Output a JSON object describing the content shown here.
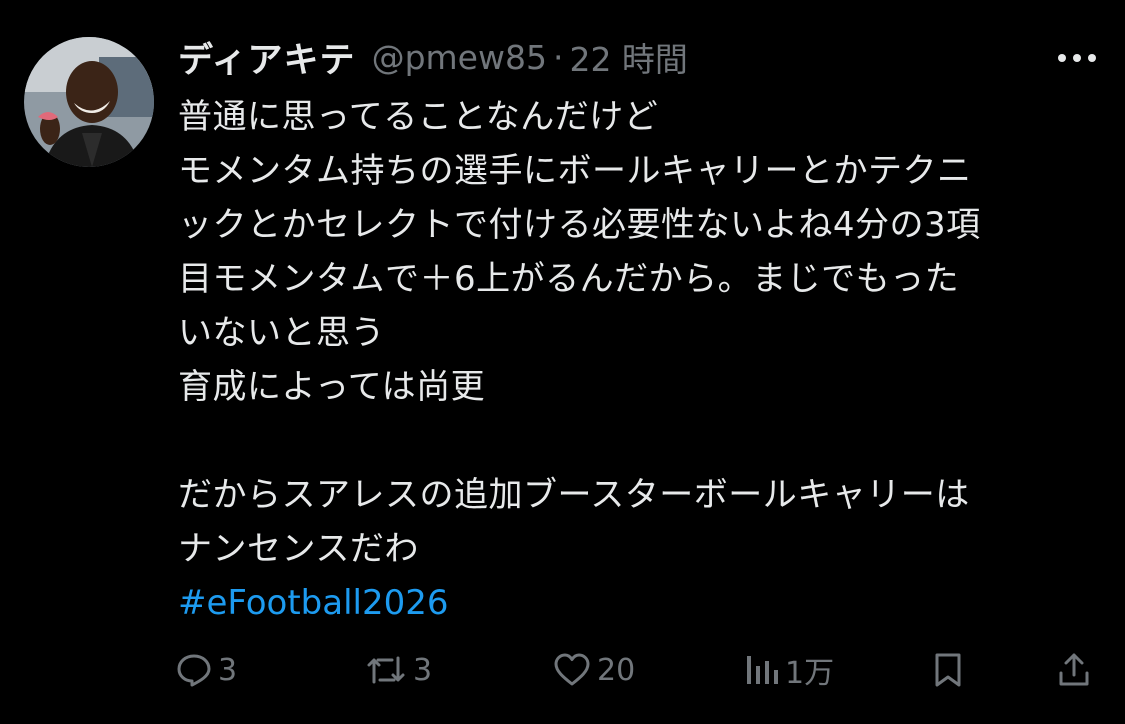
{
  "tweet": {
    "display_name": "ディアキテ",
    "handle": "@pmew85",
    "separator": "·",
    "time": "22 時間",
    "lines": [
      "普通に思ってることなんだけど",
      "モメンタム持ちの選手にボールキャリーとかテクニ",
      "ックとかセレクトで付ける必要性ないよね4分の3項",
      "目モメンタムで＋6上がるんだから。まじでもった",
      "いないと思う",
      "育成によっては尚更",
      "",
      "だからスアレスの追加ブースターボールキャリーは",
      "ナンセンスだわ"
    ],
    "hashtag": "#eFootball2026",
    "hashtag_color": "#1d9bf0"
  },
  "actions": {
    "reply": {
      "icon": "reply-icon",
      "count": "3"
    },
    "retweet": {
      "icon": "retweet-icon",
      "count": "3"
    },
    "like": {
      "icon": "heart-icon",
      "count": "20"
    },
    "views": {
      "icon": "views-icon",
      "count": "1万"
    },
    "bookmark": {
      "icon": "bookmark-icon"
    },
    "share": {
      "icon": "share-icon"
    }
  },
  "colors": {
    "background": "#000000",
    "text": "#e7e9ea",
    "muted": "#71767b",
    "accent": "#1d9bf0"
  }
}
